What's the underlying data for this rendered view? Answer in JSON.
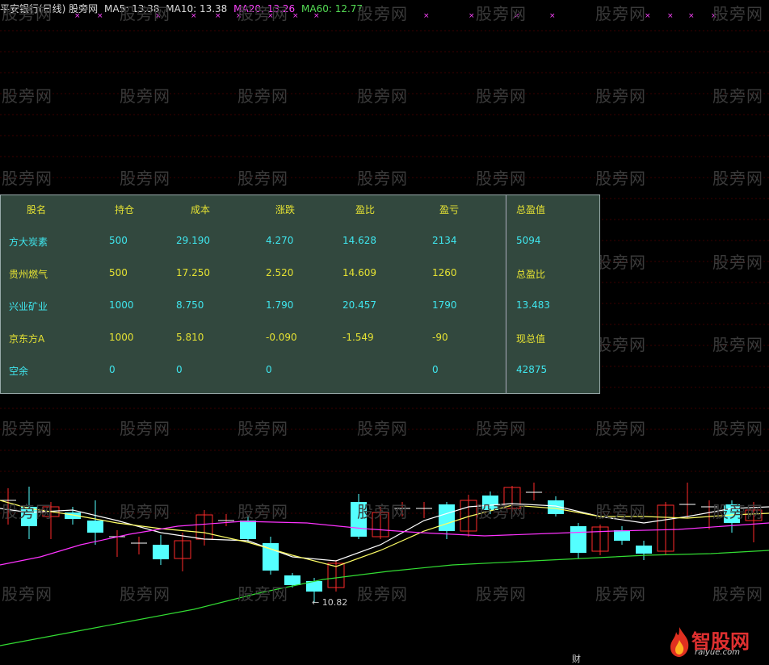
{
  "header": {
    "title": "平安银行(日线) 股旁网",
    "ma5": "MA5: 13.38",
    "ma10": "MA10: 13.38",
    "ma20": "MA20: 13.26",
    "ma60": "MA60: 12.77"
  },
  "watermark": "股旁网",
  "table": {
    "headers": [
      "股名",
      "持仓",
      "成本",
      "涨跌",
      "盈比",
      "盈亏"
    ],
    "rows": [
      {
        "name": "方大炭素",
        "pos": "500",
        "cost": "29.190",
        "chg": "4.270",
        "ratio": "14.628",
        "pl": "2134"
      },
      {
        "name": "贵州燃气",
        "pos": "500",
        "cost": "17.250",
        "chg": "2.520",
        "ratio": "14.609",
        "pl": "1260"
      },
      {
        "name": "兴业矿业",
        "pos": "1000",
        "cost": "8.750",
        "chg": "1.790",
        "ratio": "20.457",
        "pl": "1790"
      },
      {
        "name": "京东方A",
        "pos": "1000",
        "cost": "5.810",
        "chg": "-0.090",
        "ratio": "-1.549",
        "pl": "-90"
      },
      {
        "name": "空余",
        "pos": "0",
        "cost": "0",
        "chg": "0",
        "ratio": "",
        "pl": "0"
      }
    ],
    "summary": [
      {
        "label": "总盈值",
        "value": "5094"
      },
      {
        "label": "总盈比",
        "value": "13.483"
      },
      {
        "label": "现总值",
        "value": "42875"
      }
    ]
  },
  "chart": {
    "low_label": "10.82",
    "bottom_char": "财",
    "colors": {
      "up": "#ff2a2a",
      "down": "#54ffff",
      "ma5": "#ffffff",
      "ma10": "#ffff66",
      "ma20": "#ff33ff",
      "ma60": "#33dd33"
    }
  },
  "logo": {
    "text": "智股网",
    "sub": "raiyue.com"
  }
}
